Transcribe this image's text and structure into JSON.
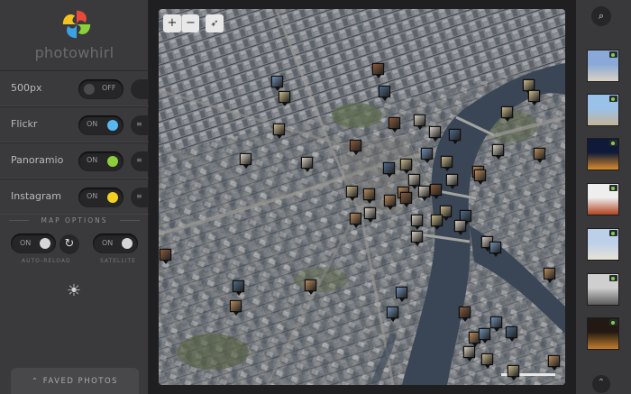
{
  "app": {
    "name": "photowhirl"
  },
  "services": [
    {
      "label": "500px",
      "state": "OFF",
      "color": "#4b4b4e",
      "extra": ""
    },
    {
      "label": "Flickr",
      "state": "ON",
      "color": "#57b9f2",
      "extra": "≡"
    },
    {
      "label": "Panoramio",
      "state": "ON",
      "color": "#8ccf3a",
      "extra": "≡"
    },
    {
      "label": "Instagram",
      "state": "ON",
      "color": "#f2d21f",
      "extra": "≡"
    }
  ],
  "map_options": {
    "heading": "MAP OPTIONS",
    "auto_reload": {
      "state": "ON",
      "label": "AUTO-RELOAD"
    },
    "satellite": {
      "state": "ON",
      "label": "SATELLITE"
    }
  },
  "faved": {
    "label": "FAVED PHOTOS",
    "icon": "chevron-up-icon"
  },
  "map": {
    "zoom_in": "+",
    "zoom_out": "−",
    "locate": "➶"
  },
  "right": {
    "search_icon": "search-icon",
    "scroll_up_icon": "chevron-up-icon",
    "thumbs": [
      {
        "colors": [
          "#8aa9d8",
          "#d9d2c3"
        ],
        "badge": true
      },
      {
        "colors": [
          "#9ac1e8",
          "#c4b496"
        ],
        "badge": true
      },
      {
        "colors": [
          "#0f1a3a",
          "#d98c2a"
        ],
        "badge": true
      },
      {
        "colors": [
          "#eeeeee",
          "#b2421e"
        ],
        "badge": true
      },
      {
        "colors": [
          "#bcd0ea",
          "#e8e2d6"
        ],
        "badge": true
      },
      {
        "colors": [
          "#cfcfcf",
          "#5b5b5b"
        ],
        "badge": true
      },
      {
        "colors": [
          "#221a12",
          "#c27d2e"
        ],
        "badge": true
      }
    ]
  }
}
